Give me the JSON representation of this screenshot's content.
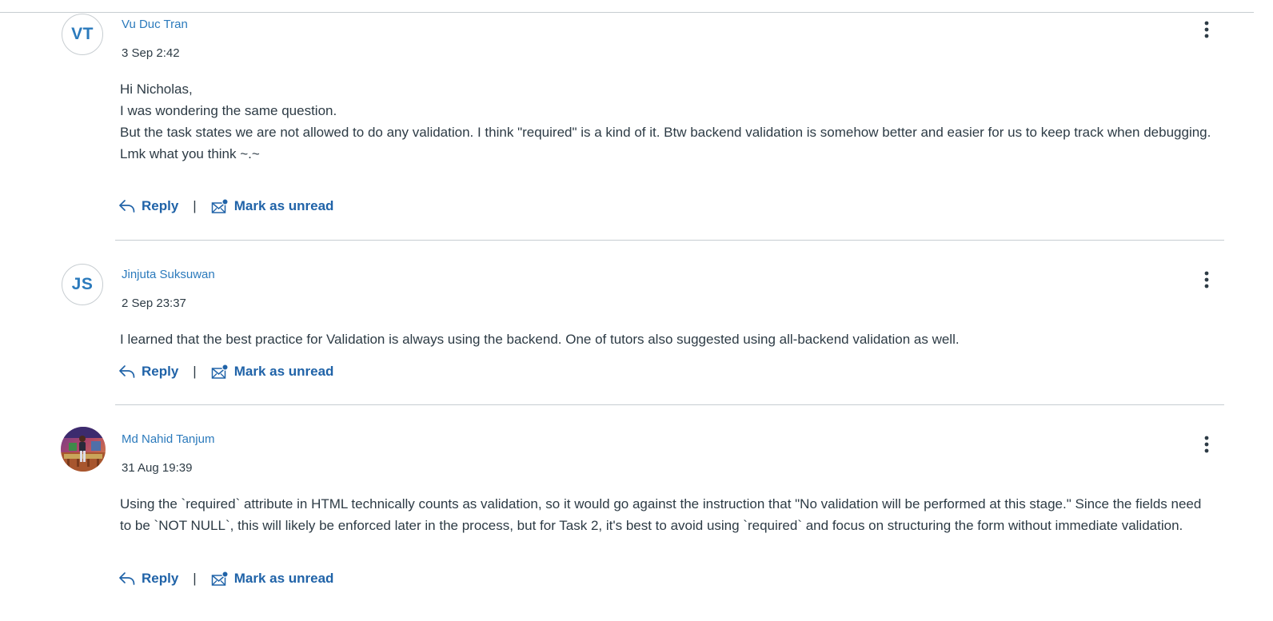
{
  "posts": [
    {
      "initials": "VT",
      "author": "Vu Duc Tran",
      "timestamp": "3 Sep 2:42",
      "body": [
        "Hi Nicholas,",
        "I was wondering the same question.",
        "But the task states we are not allowed to do any validation. I think \"required\" is a kind of it. Btw backend validation is somehow better and easier for us to keep track when debugging. Lmk what you think ~.~"
      ],
      "reply_label": "Reply",
      "separator": "|",
      "mark_unread_label": "Mark as unread"
    },
    {
      "initials": "JS",
      "author": "Jinjuta Suksuwan",
      "timestamp": "2 Sep 23:37",
      "body": [
        "I learned that the best practice for Validation is always using the backend. One of tutors also suggested using all-backend validation as well."
      ],
      "reply_label": "Reply",
      "separator": "|",
      "mark_unread_label": "Mark as unread"
    },
    {
      "initials": "",
      "author": "Md Nahid Tanjum",
      "timestamp": "31 Aug 19:39",
      "body": [
        "Using the `required` attribute in HTML technically counts as validation, so it would go against the instruction that \"No validation will be performed at this stage.\" Since the fields need to be `NOT NULL`, this will likely be enforced later in the process, but for Task 2, it's best to avoid using `required` and focus on structuring the form without immediate validation."
      ],
      "reply_label": "Reply",
      "separator": "|",
      "mark_unread_label": "Mark as unread"
    }
  ],
  "icons": {
    "reply": "reply-arrow-icon",
    "mark_unread": "envelope-unread-icon",
    "more": "more-options-icon"
  },
  "colors": {
    "author_link": "#2b7abc",
    "action_link": "#2063a8",
    "text": "#2d3b45",
    "divider": "#c7cdd1"
  }
}
